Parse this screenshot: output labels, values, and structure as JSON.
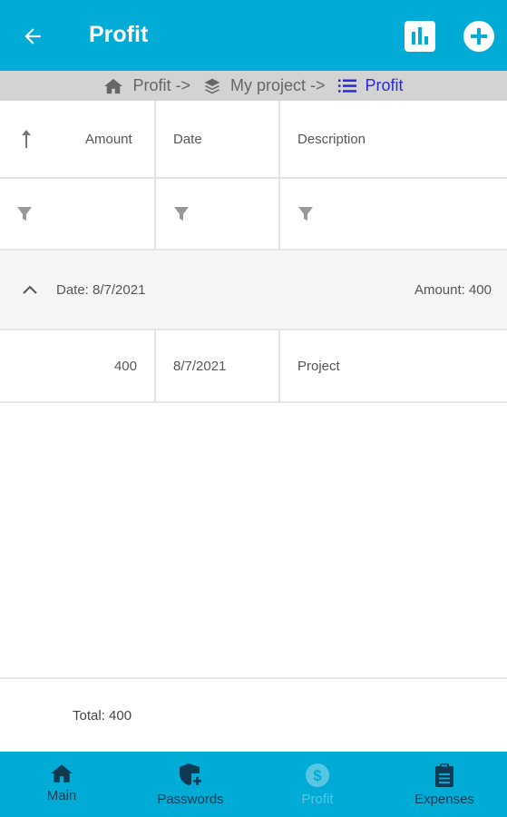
{
  "appbar": {
    "title": "Profit",
    "back_icon": "arrow-left-icon",
    "chart_icon": "bar-chart-icon",
    "add_icon": "plus-circle-icon"
  },
  "breadcrumb": {
    "items": [
      {
        "label": "Profit ->",
        "icon": "home-icon"
      },
      {
        "label": "My project ->",
        "icon": "layers-icon"
      },
      {
        "label": "Profit",
        "icon": "list-icon",
        "active": true
      }
    ]
  },
  "grid": {
    "columns": [
      "Amount",
      "Date",
      "Description"
    ],
    "sort_icon": "sort-arrow-up-icon",
    "filter_icon": "filter-icon",
    "group": {
      "label": "Date: 8/7/2021",
      "summary": "Amount: 400",
      "icon": "chevron-up-icon"
    },
    "rows": [
      {
        "amount": "400",
        "date": "8/7/2021",
        "description": "Project"
      }
    ]
  },
  "footer": {
    "total": "Total: 400"
  },
  "bottom_nav": {
    "items": [
      {
        "label": "Main",
        "icon": "home-icon"
      },
      {
        "label": "Passwords",
        "icon": "shield-plus-icon"
      },
      {
        "label": "Profit",
        "icon": "dollar-circle-icon",
        "disabled": true
      },
      {
        "label": "Expenses",
        "icon": "clipboard-icon"
      }
    ]
  },
  "colors": {
    "primary": "#00acd6",
    "nav_text": "#0e3a52",
    "breadcrumb_active": "#2a2ad6",
    "breadcrumb_bg": "#d3d3d3"
  }
}
